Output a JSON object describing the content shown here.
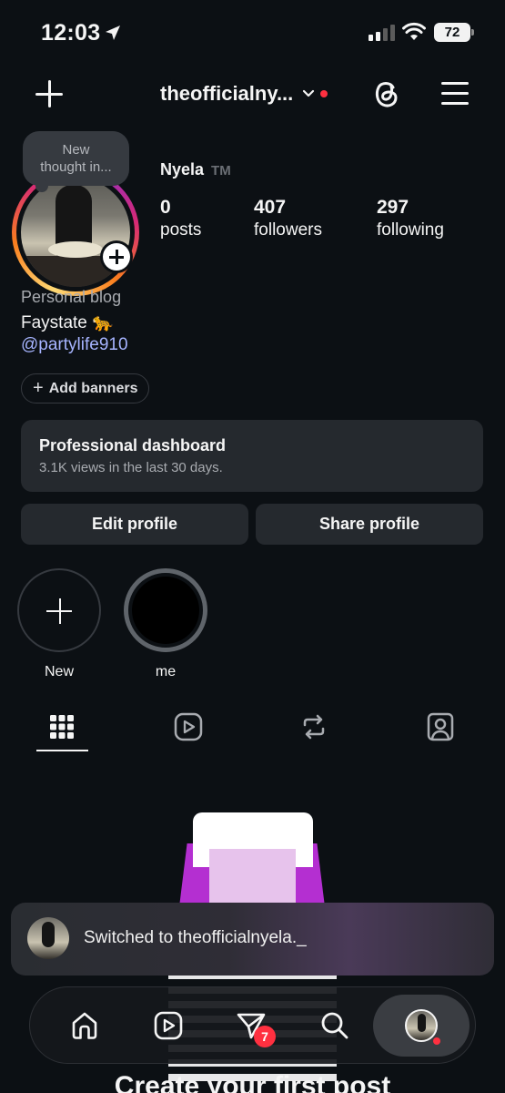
{
  "status_bar": {
    "time": "12:03",
    "battery": "72"
  },
  "header": {
    "username": "theofficialny..."
  },
  "profile": {
    "thought_bubble": "New\nthought in...",
    "display_name": "Nyela",
    "tm": "TM",
    "stats": [
      {
        "value": "0",
        "label": "posts"
      },
      {
        "value": "407",
        "label": "followers"
      },
      {
        "value": "297",
        "label": "following"
      }
    ],
    "category": "Personal blog",
    "bio_line": "Faystate 🐆",
    "bio_link": "@partylife910",
    "add_banners": "Add banners"
  },
  "dashboard": {
    "title": "Professional dashboard",
    "subtitle": "3.1K views in the last 30 days."
  },
  "buttons": {
    "edit_profile": "Edit profile",
    "share_profile": "Share profile"
  },
  "highlights": [
    {
      "label": "New"
    },
    {
      "label": "me"
    }
  ],
  "content_tabs": [
    "grid-icon",
    "reels-icon",
    "reposts-icon",
    "tagged-icon"
  ],
  "empty_state": {
    "title": "Create your first post"
  },
  "toast": {
    "text": "Switched to theofficialnyela._"
  },
  "tabbar": {
    "notifications_badge": "7"
  },
  "colors": {
    "background": "#0c1014",
    "card": "#25292e",
    "accent_red": "#ff3040",
    "link": "#a6b4ff"
  }
}
